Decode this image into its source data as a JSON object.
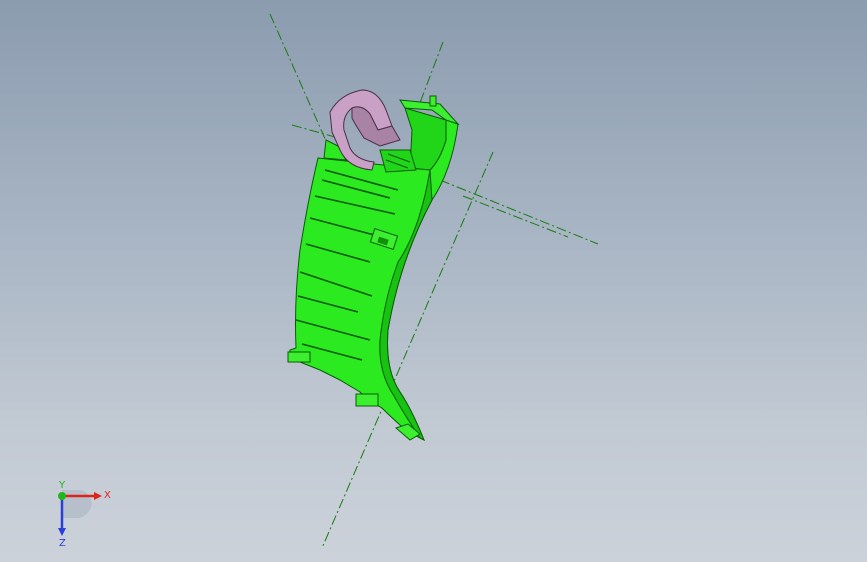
{
  "viewport": {
    "background_top": "#8b9caf",
    "background_bottom": "#ccd2da"
  },
  "model": {
    "part_color": "#22e01a",
    "edge_color": "#0b5a07",
    "clip_color": "#c9a1c6",
    "centerline_color": "#1a7a12"
  },
  "triad": {
    "x_label": "X",
    "y_label": "Y",
    "z_label": "Z",
    "x_color": "#e0241c",
    "y_color": "#21b61a",
    "z_color": "#2a3fd6"
  }
}
